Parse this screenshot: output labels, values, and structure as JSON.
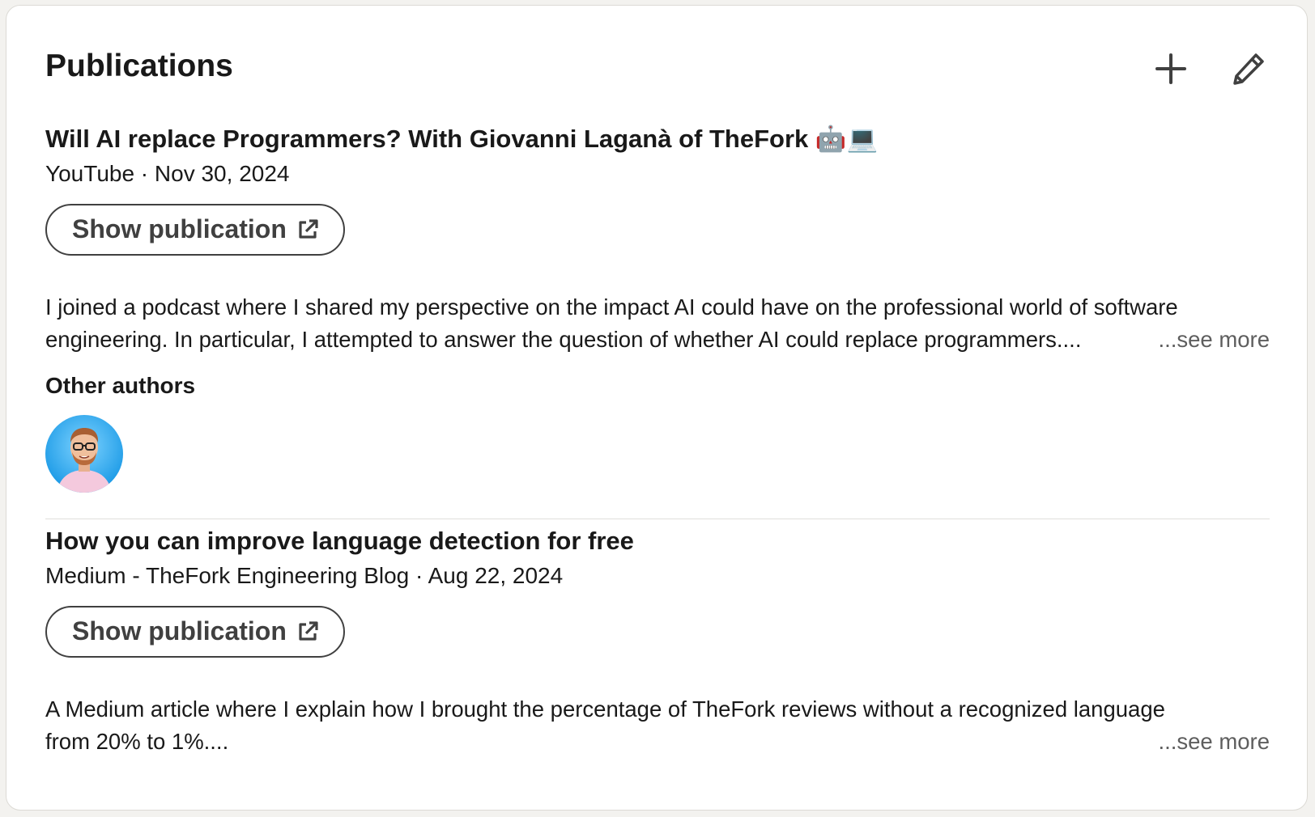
{
  "section": {
    "title": "Publications",
    "add_icon": "plus-icon",
    "edit_icon": "pencil-icon"
  },
  "publications": [
    {
      "title": "Will AI replace Programmers? With Giovanni Laganà of TheFork 🤖💻",
      "meta": "YouTube · Nov 30, 2024",
      "button_label": "Show publication",
      "button_icon": "external-link-icon",
      "description_lines": [
        "I joined a podcast where I shared my perspective on the impact AI could have on the professional world of software",
        "engineering. In particular, I attempted to answer the question of whether AI could replace programmers...."
      ],
      "see_more": "...see more",
      "other_authors_label": "Other authors"
    },
    {
      "title": "How you can improve language detection for free",
      "meta": "Medium - TheFork Engineering Blog · Aug 22, 2024",
      "button_label": "Show publication",
      "button_icon": "external-link-icon",
      "description_lines": [
        "A Medium article where I explain how I brought the percentage of TheFork reviews without a recognized language",
        "from 20% to 1%...."
      ],
      "see_more": "...see more"
    }
  ],
  "colors": {
    "page_background": "#f3f2ef",
    "card_background": "#ffffff",
    "text_primary": "#191919",
    "text_muted": "#5e5e5e",
    "button_border": "#404040"
  }
}
